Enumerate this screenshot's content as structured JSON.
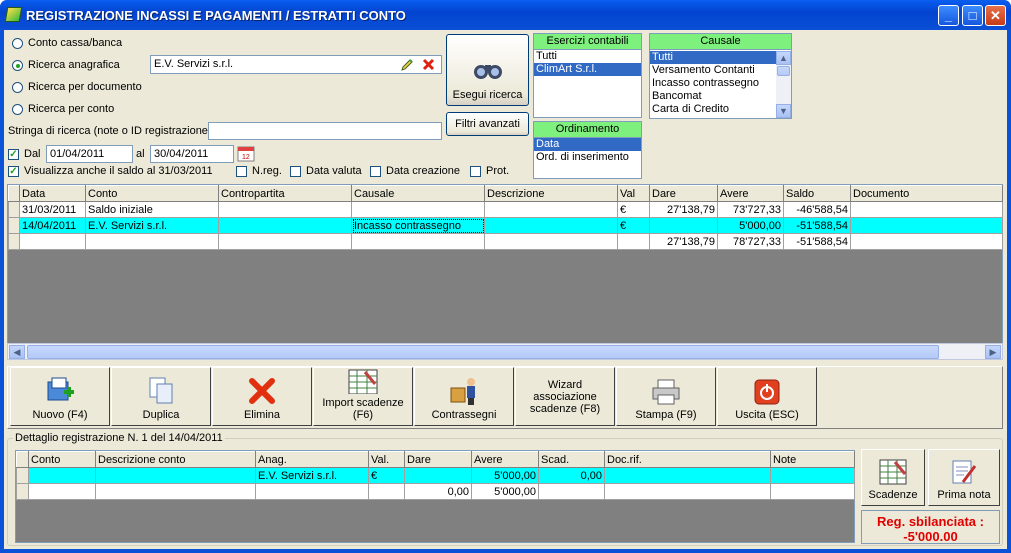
{
  "window": {
    "title": "REGISTRAZIONE INCASSI E PAGAMENTI / ESTRATTI CONTO"
  },
  "search": {
    "modes": [
      "Conto cassa/banca",
      "Ricerca anagrafica",
      "Ricerca per documento",
      "Ricerca per conto"
    ],
    "selected_mode": "Ricerca anagrafica",
    "anagrafica_value": "E.V. Servizi s.r.l.",
    "string_label": "Stringa di ricerca (note o ID registrazione)",
    "string_value": "",
    "dal_label": "Dal",
    "dal_value": "01/04/2011",
    "al_label": "al",
    "al_value": "30/04/2011",
    "show_balance_label": "Visualizza anche il saldo al 31/03/2011",
    "nreg_label": "N.reg.",
    "data_valuta_label": "Data valuta",
    "data_creazione_label": "Data creazione",
    "prot_label": "Prot.",
    "run_label": "Esegui ricerca",
    "advanced_label": "Filtri avanzati"
  },
  "esercizi": {
    "header": "Esercizi contabili",
    "items": [
      "Tutti",
      "ClimArt S.r.l."
    ],
    "selected": 1
  },
  "causale": {
    "header": "Causale",
    "items": [
      "Tutti",
      "Versamento Contanti",
      "Incasso contrassegno",
      "Bancomat",
      "Carta di Credito"
    ],
    "selected": 0
  },
  "ordinamento": {
    "header": "Ordinamento",
    "items": [
      "Data",
      "Ord. di inserimento"
    ],
    "selected": 0
  },
  "main_table": {
    "columns": [
      "Data",
      "Conto",
      "Contropartita",
      "Causale",
      "Descrizione",
      "Val",
      "Dare",
      "Avere",
      "Saldo",
      "Documento"
    ],
    "rows": [
      [
        "31/03/2011",
        "Saldo iniziale",
        "",
        "",
        "",
        "€",
        "27'138,79",
        "73'727,33",
        "-46'588,54",
        ""
      ],
      [
        "14/04/2011",
        "E.V. Servizi s.r.l.",
        "",
        "Incasso contrassegno",
        "",
        "€",
        "",
        "5'000,00",
        "-51'588,54",
        ""
      ],
      [
        "",
        "",
        "",
        "",
        "",
        "",
        "27'138,79",
        "78'727,33",
        "-51'588,54",
        ""
      ]
    ]
  },
  "toolbar": {
    "nuovo": "Nuovo (F4)",
    "duplica": "Duplica",
    "elimina": "Elimina",
    "import": "Import scadenze (F6)",
    "contrassegni": "Contrassegni",
    "wizard": "Wizard associazione scadenze (F8)",
    "stampa": "Stampa (F9)",
    "uscita": "Uscita (ESC)"
  },
  "detail": {
    "title": "Dettaglio registrazione N. 1 del 14/04/2011",
    "columns": [
      "Conto",
      "Descrizione conto",
      "Anag.",
      "Val.",
      "Dare",
      "Avere",
      "Scad.",
      "Doc.rif.",
      "Note"
    ],
    "rows": [
      [
        "",
        "",
        "E.V. Servizi s.r.l.",
        "€",
        "",
        "5'000,00",
        "0,00",
        "",
        ""
      ],
      [
        "",
        "",
        "",
        "",
        "0,00",
        "5'000,00",
        "",
        "",
        ""
      ]
    ],
    "scadenze_label": "Scadenze",
    "prima_nota_label": "Prima nota",
    "alert_line1": "Reg. sbilanciata :",
    "alert_line2": "-5'000.00"
  },
  "colors": {
    "accent": "#316ac5",
    "highlight": "#00ffff",
    "header_green": "#7ef07e",
    "alert": "#e00000"
  }
}
